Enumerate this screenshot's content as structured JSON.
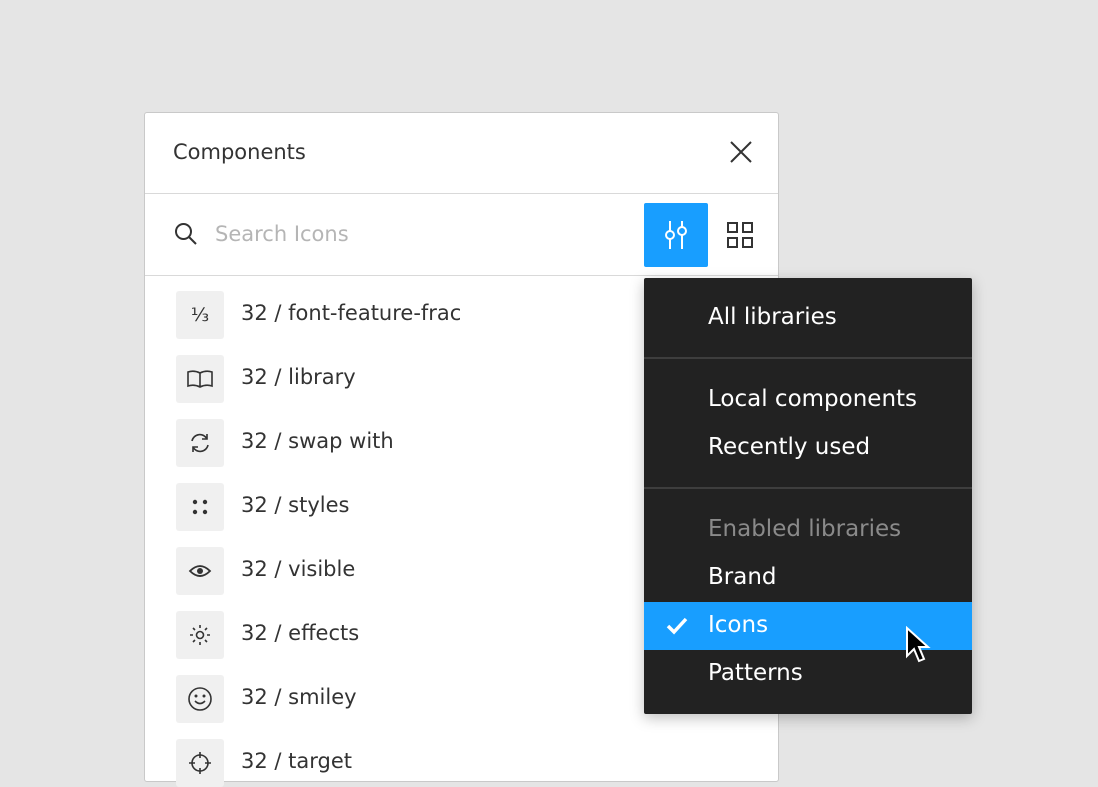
{
  "panel": {
    "title": "Components",
    "close_icon": "close-icon",
    "search": {
      "placeholder": "Search Icons",
      "value": ""
    },
    "filter_button_color": "#189eff"
  },
  "items": [
    {
      "label": "32 / font-feature-frac",
      "glyph": "⅓"
    },
    {
      "label": "32 / library",
      "icon": "book-icon"
    },
    {
      "label": "32 / swap with",
      "icon": "swap-icon"
    },
    {
      "label": "32 / styles",
      "icon": "styles-icon"
    },
    {
      "label": "32 / visible",
      "icon": "eye-icon"
    },
    {
      "label": "32 / effects",
      "icon": "sun-icon"
    },
    {
      "label": "32 / smiley",
      "icon": "smiley-icon"
    },
    {
      "label": "32 / target",
      "icon": "target-icon"
    }
  ],
  "menu": {
    "all": "All libraries",
    "local": "Local components",
    "recent": "Recently used",
    "enabled_heading": "Enabled libraries",
    "brand": "Brand",
    "icons": "Icons",
    "patterns": "Patterns",
    "selected": "Icons",
    "background": "#222222",
    "highlight": "#189eff"
  }
}
